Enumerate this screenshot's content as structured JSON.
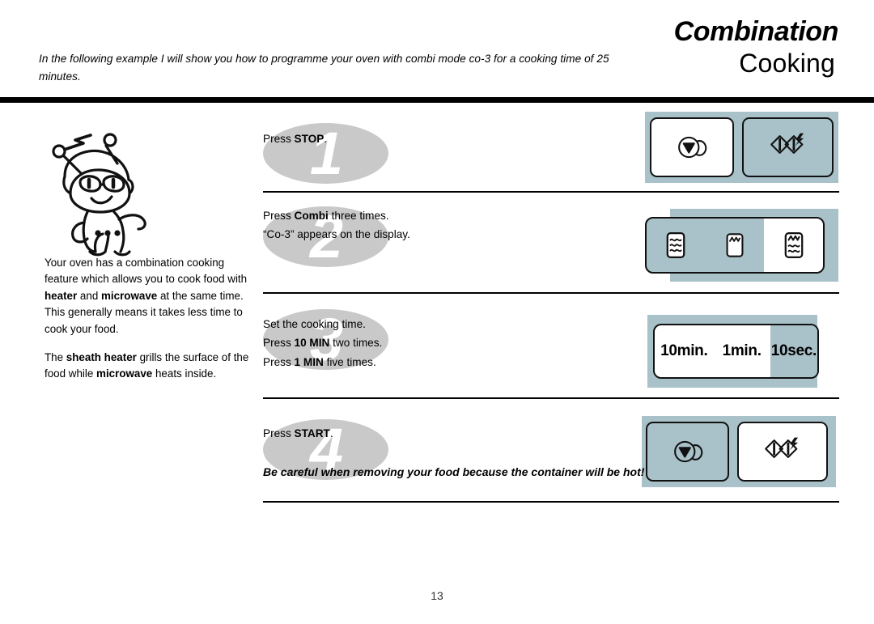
{
  "header": {
    "title_main": "Combination",
    "title_sub": "Cooking",
    "intro": "In the following example I will show you how to programme your oven with combi mode co-3 for a cooking time of 25 minutes."
  },
  "left_column": {
    "mascot_icon": "robot-mascot-illustration",
    "paragraphs": [
      {
        "parts": [
          {
            "text": "Your oven has a combination cooking feature which allows you to cook food with ",
            "bold": false
          },
          {
            "text": "heater",
            "bold": true
          },
          {
            "text": " and ",
            "bold": false
          },
          {
            "text": "microwave",
            "bold": true
          },
          {
            "text": " at the same time. This generally means it takes less time to cook your food.",
            "bold": false
          }
        ]
      },
      {
        "parts": [
          {
            "text": "The ",
            "bold": false
          },
          {
            "text": "sheath heater",
            "bold": true
          },
          {
            "text": " grills the surface of the food while ",
            "bold": false
          },
          {
            "text": "microwave",
            "bold": true
          },
          {
            "text": " heats inside.",
            "bold": false
          }
        ]
      }
    ]
  },
  "steps": [
    {
      "number": "1",
      "lines": [
        [
          {
            "text": "Press ",
            "bold": false
          },
          {
            "text": "STOP",
            "bold": true
          },
          {
            "text": ".",
            "bold": false
          }
        ]
      ],
      "warning": "",
      "panel": {
        "type": "two-buttons",
        "buttons": [
          {
            "icon": "start-button-icon",
            "state": "active"
          },
          {
            "icon": "stop-clear-button-icon",
            "state": "inactive"
          }
        ]
      }
    },
    {
      "number": "2",
      "lines": [
        [
          {
            "text": "Press ",
            "bold": false
          },
          {
            "text": "Combi",
            "bold": true
          },
          {
            "text": " three times.",
            "bold": false
          }
        ],
        [
          {
            "text": "“Co-3” appears on the display.",
            "bold": false
          }
        ]
      ],
      "warning": "",
      "panel": {
        "type": "mode-bar",
        "cells": [
          {
            "icon": "microwave-mode-icon",
            "selected": false
          },
          {
            "icon": "grill-mode-icon",
            "selected": false
          },
          {
            "icon": "combi-mode-icon",
            "selected": true
          }
        ]
      }
    },
    {
      "number": "3",
      "lines": [
        [
          {
            "text": "Set the cooking time.",
            "bold": false
          }
        ],
        [
          {
            "text": "Press ",
            "bold": false
          },
          {
            "text": "10 MIN",
            "bold": true
          },
          {
            "text": " two times.",
            "bold": false
          }
        ],
        [
          {
            "text": "Press ",
            "bold": false
          },
          {
            "text": "1 MIN",
            "bold": true
          },
          {
            "text": " five times.",
            "bold": false
          }
        ]
      ],
      "warning": "",
      "panel": {
        "type": "display-bar",
        "cells": [
          {
            "label": "10min.",
            "selected": true
          },
          {
            "label": "1min.",
            "selected": true
          },
          {
            "label": "10sec.",
            "selected": false
          }
        ]
      }
    },
    {
      "number": "4",
      "lines": [
        [
          {
            "text": "Press ",
            "bold": false
          },
          {
            "text": "START",
            "bold": true
          },
          {
            "text": ".",
            "bold": false
          }
        ]
      ],
      "warning": "Be careful when removing your food because the container will be hot!",
      "panel": {
        "type": "two-buttons",
        "buttons": [
          {
            "icon": "start-button-icon",
            "state": "inactive"
          },
          {
            "icon": "stop-clear-button-icon",
            "state": "active"
          }
        ]
      }
    }
  ],
  "footer": {
    "page_number": "13"
  },
  "colors": {
    "panel_background": "#a9c1c9",
    "step_number_fill": "#c9c9c9",
    "rule": "#000000",
    "page_background": "#ffffff"
  }
}
